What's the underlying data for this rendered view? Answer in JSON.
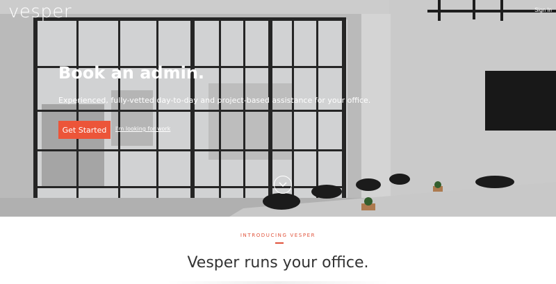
{
  "brand": {
    "logo_text": "vesper"
  },
  "nav": {
    "signin_label": "Sign In"
  },
  "hero": {
    "headline": "Book an admin.",
    "subtitle": "Experienced, fully-vetted day-to-day and project-based assistance for your office.",
    "cta_label": "Get Started",
    "secondary_link": "I'm looking for work",
    "scroll_icon": "chevron-down-icon"
  },
  "intro": {
    "eyebrow": "INTRODUCING VESPER",
    "title": "Vesper runs your office."
  },
  "colors": {
    "accent": "#ec5539",
    "text_dark": "#333333",
    "white": "#ffffff"
  }
}
